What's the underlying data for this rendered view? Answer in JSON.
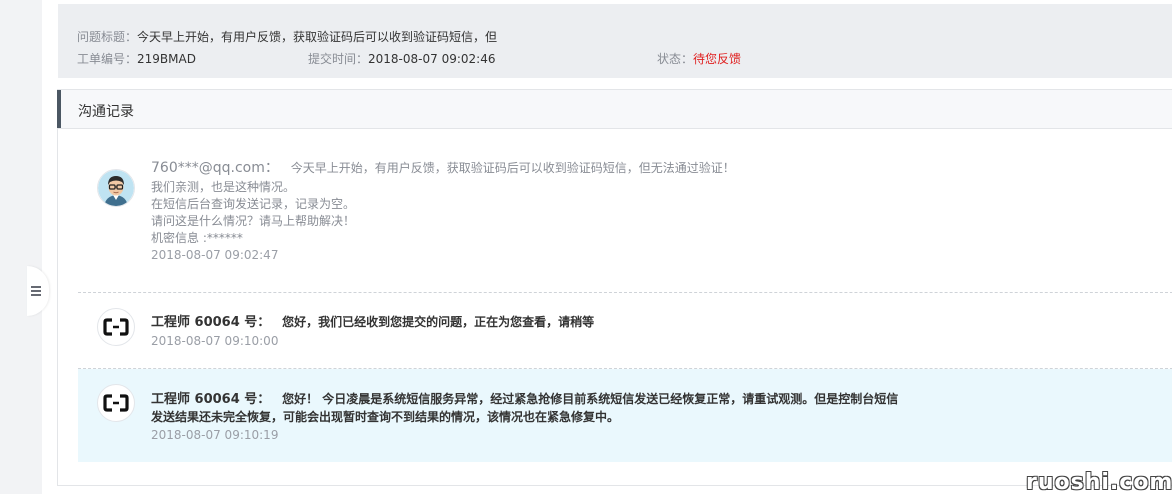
{
  "ticket_info": {
    "title_key": "问题标题：",
    "title_value": "今天早上开始，有用户反馈，获取验证码后可以收到验证码短信，但",
    "id_key": "工单编号：",
    "id_value": "219BMAD",
    "submit_time_key": "提交时间：",
    "submit_time_value": "2018-08-07 09:02:46",
    "status_key": "状态：",
    "status_value": "待您反馈",
    "status_color": "#e02020"
  },
  "comm": {
    "title": "沟通记录",
    "messages": [
      {
        "sender": "760***@qq.com：",
        "lines": [
          "今天早上开始，有用户反馈，获取验证码后可以收到验证码短信，但无法通过验证！",
          "我们亲测，也是这种情况。",
          "在短信后台查询发送记录，记录为空。",
          "请问这是什么情况？请马上帮助解决！",
          "机密信息 :******"
        ],
        "time": "2018-08-07 09:02:47",
        "avatar_icon": "user-avatar-icon"
      },
      {
        "sender": "工程师 60064 号：",
        "lines": [
          "您好，我们已经收到您提交的问题，正在为您查看，请稍等"
        ],
        "time": "2018-08-07 09:10:00",
        "avatar_icon": "aliyun-logo-icon"
      },
      {
        "sender": "工程师 60064 号：",
        "lines": [
          "您好！ 今日凌晨是系统短信服务异常，经过紧急抢修目前系统短信发送已经恢复正常，请重试观测。但是控制台短信",
          "发送结果还未完全恢复，可能会出现暂时查询不到结果的情况，该情况也在紧急修复中。"
        ],
        "time": "2018-08-07 09:10:19",
        "avatar_icon": "aliyun-logo-icon"
      }
    ]
  },
  "watermark": "ruoshi.com",
  "colors": {
    "highlight_bg": "#eaf8fd",
    "accent_bar": "#4b5763"
  }
}
